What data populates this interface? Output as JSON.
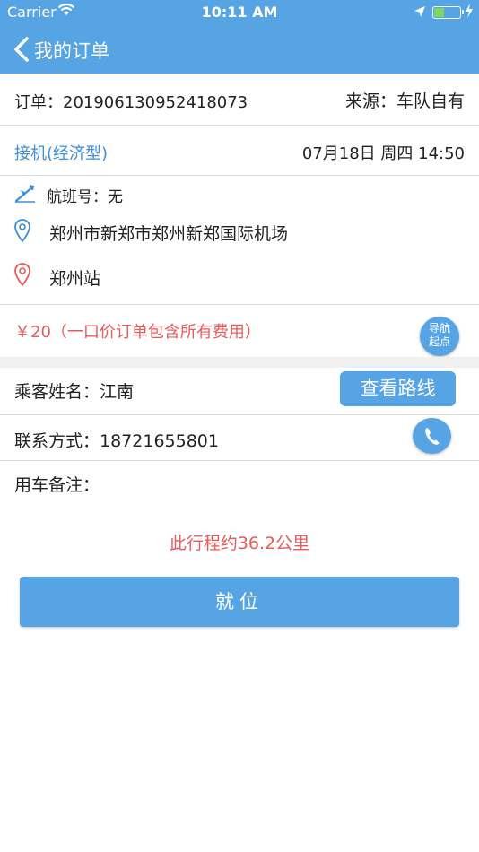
{
  "status_bar": {
    "carrier": "Carrier",
    "time": "10:11 AM"
  },
  "nav": {
    "title": "我的订单"
  },
  "order": {
    "number_label": "订单：20190613095241807З",
    "source": "来源：车队自有"
  },
  "service": {
    "type": "接机(经济型)",
    "datetime": "07月18日 周四 14:50"
  },
  "flight": {
    "text": "航班号：无"
  },
  "route": {
    "from": "郑州市新郑市郑州新郑国际机场",
    "to": "郑州站"
  },
  "price": {
    "text": "￥20（一口价订单包含所有费用）"
  },
  "navigate_button": {
    "line1": "导航",
    "line2": "起点"
  },
  "passenger": {
    "text": "乘客姓名：江南"
  },
  "view_route_button": {
    "label": "查看路线"
  },
  "contact": {
    "text": "联系方式：18721655801"
  },
  "remark": {
    "text": "用车备注："
  },
  "distance": {
    "text": "此行程约36.2公里"
  },
  "main_button": {
    "label": "就位"
  },
  "colors": {
    "accent": "#56a4e3",
    "link": "#3d8fd8",
    "alert": "#e95a5a"
  }
}
